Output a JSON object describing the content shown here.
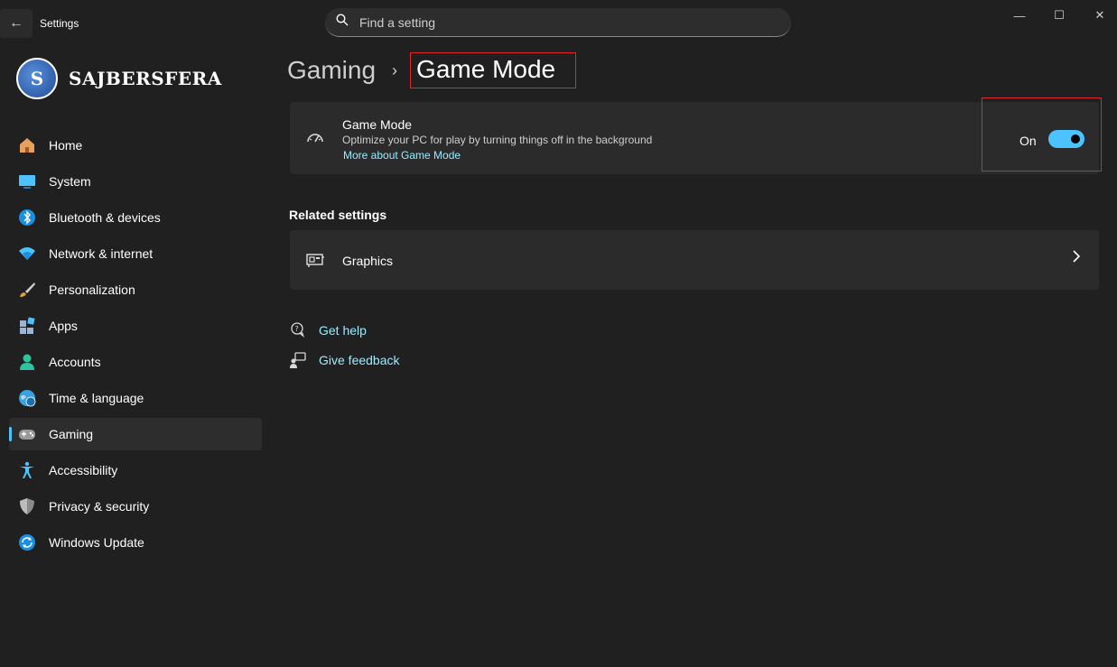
{
  "window": {
    "title": "Settings"
  },
  "search": {
    "placeholder": "Find a setting"
  },
  "window_controls": {
    "minimize": "—",
    "maximize": "☐",
    "close": "✕"
  },
  "logo": {
    "text": "SAJBERSFERA"
  },
  "nav": {
    "items": [
      {
        "label": "Home",
        "icon": "home-icon"
      },
      {
        "label": "System",
        "icon": "system-icon"
      },
      {
        "label": "Bluetooth & devices",
        "icon": "bluetooth-icon"
      },
      {
        "label": "Network & internet",
        "icon": "wifi-icon"
      },
      {
        "label": "Personalization",
        "icon": "brush-icon"
      },
      {
        "label": "Apps",
        "icon": "apps-icon"
      },
      {
        "label": "Accounts",
        "icon": "accounts-icon"
      },
      {
        "label": "Time & language",
        "icon": "globe-icon"
      },
      {
        "label": "Gaming",
        "icon": "gamepad-icon",
        "active": true
      },
      {
        "label": "Accessibility",
        "icon": "accessibility-icon"
      },
      {
        "label": "Privacy & security",
        "icon": "shield-icon"
      },
      {
        "label": "Windows Update",
        "icon": "update-icon"
      }
    ]
  },
  "breadcrumb": {
    "parent": "Gaming",
    "current": "Game Mode"
  },
  "game_mode": {
    "title": "Game Mode",
    "description": "Optimize your PC for play by turning things off in the background",
    "link": "More about Game Mode",
    "toggle_label": "On",
    "toggle_on": true
  },
  "related": {
    "heading": "Related settings",
    "graphics_label": "Graphics"
  },
  "help": {
    "get_help": "Get help",
    "give_feedback": "Give feedback"
  },
  "colors": {
    "accent": "#4cc2ff",
    "link": "#99ebff",
    "highlight_border": "#e0262b",
    "background": "#202020",
    "card": "#2b2b2b"
  }
}
